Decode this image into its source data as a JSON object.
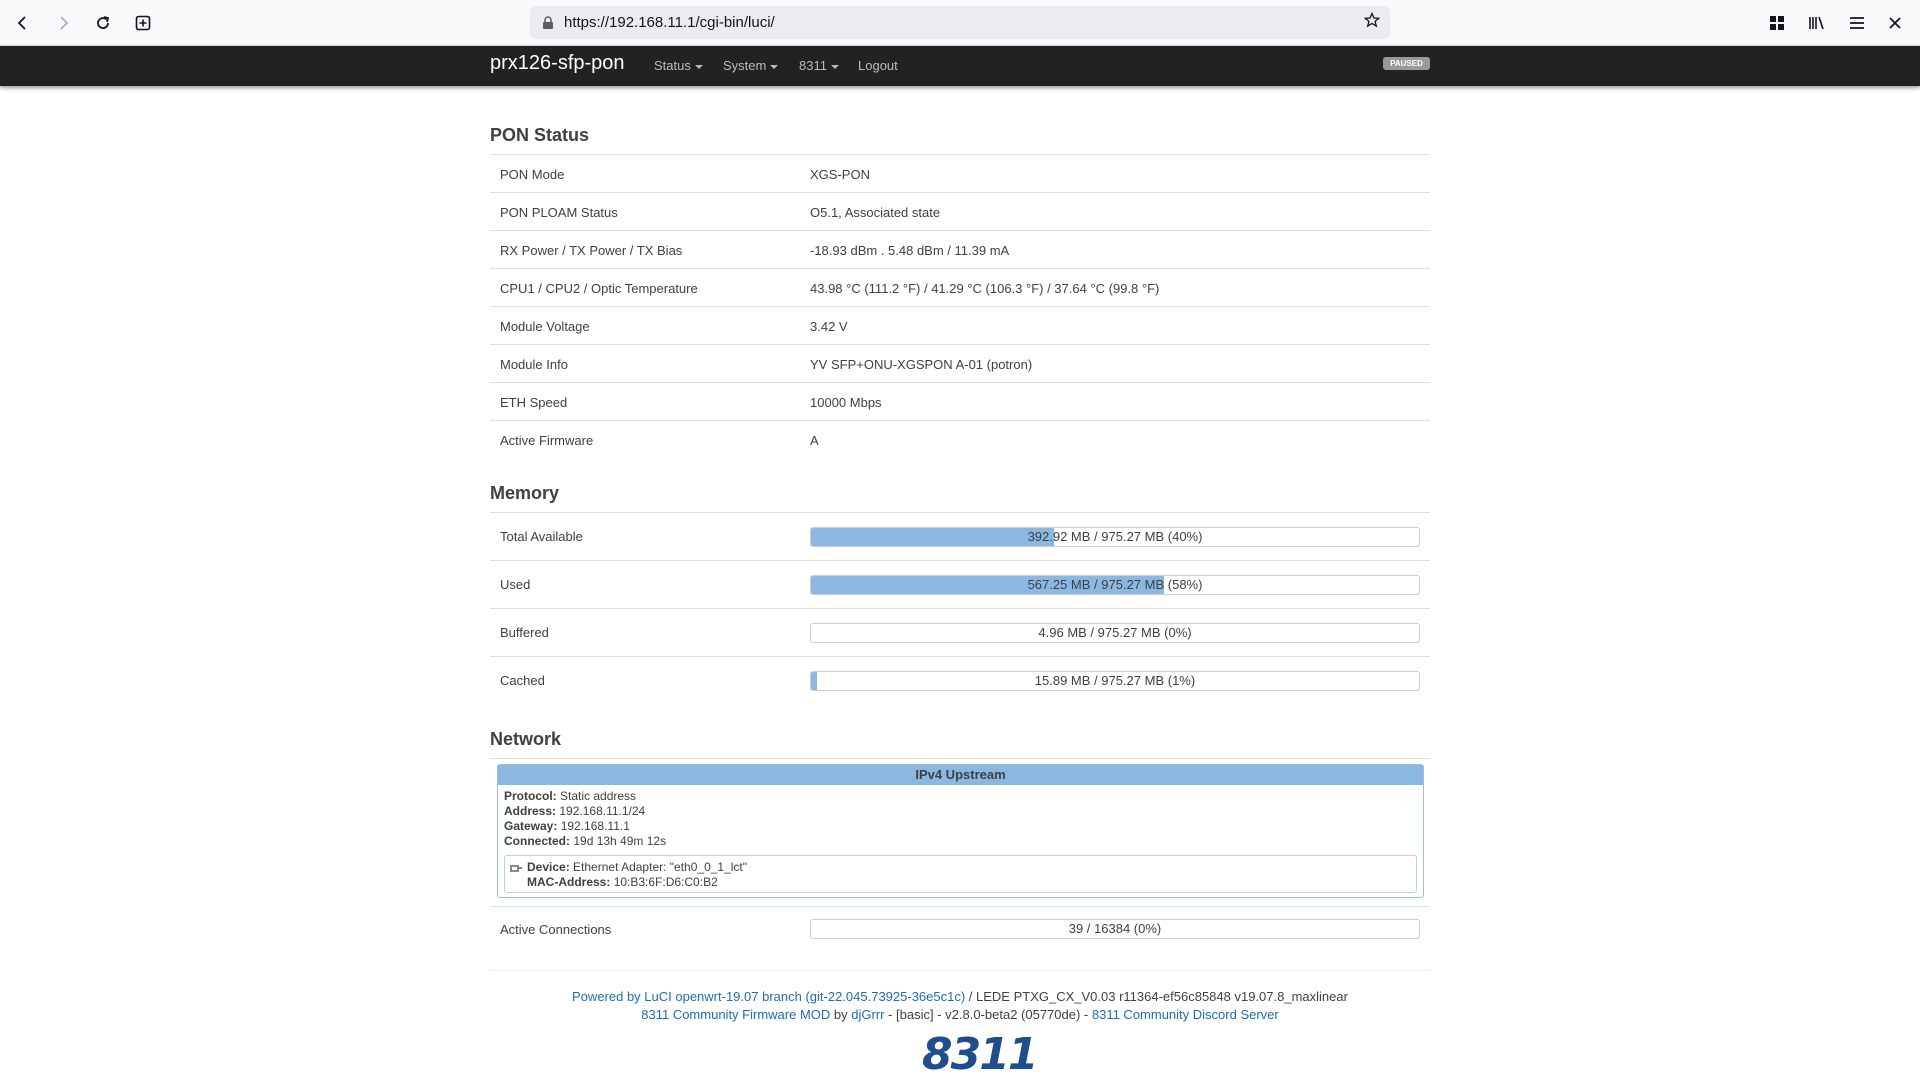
{
  "browser": {
    "url": "https://192.168.11.1/cgi-bin/luci/"
  },
  "header": {
    "brand": "prx126-sfp-pon",
    "menu": [
      "Status",
      "System",
      "8311"
    ],
    "logout": "Logout",
    "badge": "PAUSED"
  },
  "pon": {
    "title": "PON Status",
    "rows": [
      {
        "label": "PON Mode",
        "value": "XGS-PON"
      },
      {
        "label": "PON PLOAM Status",
        "value": "O5.1, Associated state"
      },
      {
        "label": "RX Power / TX Power / TX Bias",
        "value": "-18.93 dBm . 5.48 dBm / 11.39 mA"
      },
      {
        "label": "CPU1 / CPU2 / Optic Temperature",
        "value": "43.98 °C (111.2 °F) / 41.29 °C (106.3 °F) / 37.64 °C (99.8 °F)"
      },
      {
        "label": "Module Voltage",
        "value": "3.42 V"
      },
      {
        "label": "Module Info",
        "value": "YV SFP+ONU-XGSPON A-01 (potron)"
      },
      {
        "label": "ETH Speed",
        "value": "10000 Mbps"
      },
      {
        "label": "Active Firmware",
        "value": "A"
      }
    ]
  },
  "memory": {
    "title": "Memory",
    "rows": [
      {
        "label": "Total Available",
        "text": "392.92 MB / 975.27 MB (40%)",
        "fraction": 0.4
      },
      {
        "label": "Used",
        "text": "567.25 MB / 975.27 MB (58%)",
        "fraction": 0.58
      },
      {
        "label": "Buffered",
        "text": "4.96 MB / 975.27 MB (0%)",
        "fraction": 0.0
      },
      {
        "label": "Cached",
        "text": "15.89 MB / 975.27 MB (1%)",
        "fraction": 0.01
      }
    ]
  },
  "network": {
    "title": "Network",
    "box_title": "IPv4 Upstream",
    "protocol_label": "Protocol:",
    "protocol": "Static address",
    "address_label": "Address:",
    "address": "192.168.11.1/24",
    "gateway_label": "Gateway:",
    "gateway": "192.168.11.1",
    "connected_label": "Connected:",
    "connected": "19d 13h 49m 12s",
    "device_label": "Device:",
    "device": "Ethernet Adapter: \"eth0_0_1_lct\"",
    "mac_label": "MAC-Address:",
    "mac": "10:B3:6F:D6:C0:B2",
    "active_conn_label": "Active Connections",
    "active_conn_text": "39 / 16384 (0%)",
    "active_conn_fraction": 0.0
  },
  "footer": {
    "luci_link": "Powered by LuCI openwrt-19.07 branch (git-22.045.73925-36e5c1c)",
    "lede_text": " / LEDE PTXG_CX_V0.03 r11364-ef56c85848 v19.07.8_maxlinear",
    "mod_link": "8311 Community Firmware MOD",
    "by_text": " by ",
    "author_link": "djGrrr",
    "version_text": " - [basic] - v2.8.0-beta2 (05770de) - ",
    "discord_link": "8311 Community Discord Server",
    "logo": "8311"
  }
}
